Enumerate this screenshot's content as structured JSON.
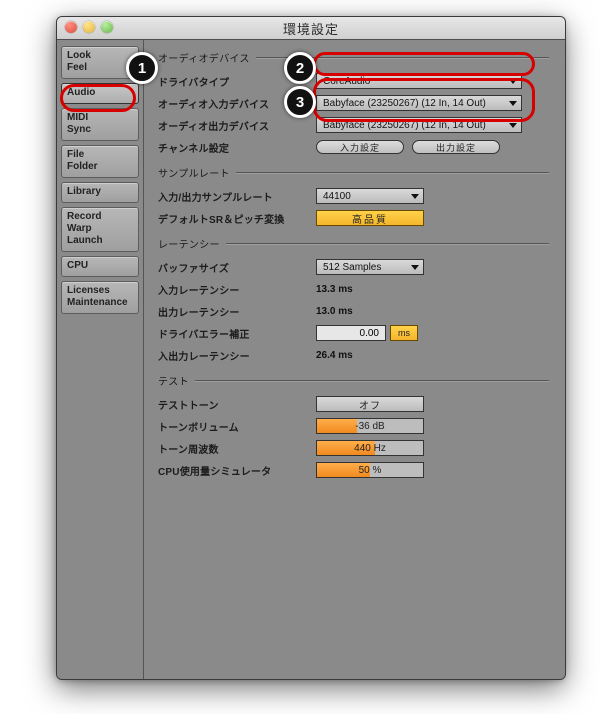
{
  "window": {
    "title": "環境設定"
  },
  "sidebar": {
    "tabs": [
      {
        "lines": [
          "Look",
          "Feel"
        ]
      },
      {
        "lines": [
          "Audio"
        ],
        "selected": true
      },
      {
        "lines": [
          "MIDI",
          "Sync"
        ]
      },
      {
        "lines": [
          "File",
          "Folder"
        ]
      },
      {
        "lines": [
          "Library"
        ]
      },
      {
        "lines": [
          "Record",
          "Warp",
          "Launch"
        ]
      },
      {
        "lines": [
          "CPU"
        ]
      },
      {
        "lines": [
          "Licenses",
          "Maintenance"
        ]
      }
    ]
  },
  "sections": {
    "device": {
      "header": "オーディオデバイス",
      "driver_type": {
        "label": "ドライバタイプ",
        "value": "CoreAudio"
      },
      "input_device": {
        "label": "オーディオ入力デバイス",
        "value": "Babyface (23250267) (12 In, 14 Out)"
      },
      "output_device": {
        "label": "オーディオ出力デバイス",
        "value": "Babyface (23250267) (12 In, 14 Out)"
      },
      "channel_config": {
        "label": "チャンネル設定",
        "input_btn": "入力設定",
        "output_btn": "出力設定"
      }
    },
    "samplerate": {
      "header": "サンプルレート",
      "io_rate": {
        "label": "入力/出力サンプルレート",
        "value": "44100"
      },
      "default_sr": {
        "label": "デフォルトSR＆ピッチ変換",
        "value": "高品質"
      }
    },
    "latency": {
      "header": "レーテンシー",
      "buffer": {
        "label": "バッファサイズ",
        "value": "512 Samples"
      },
      "in": {
        "label": "入力レーテンシー",
        "value": "13.3 ms"
      },
      "out": {
        "label": "出力レーテンシー",
        "value": "13.0 ms"
      },
      "drv": {
        "label": "ドライバエラー補正",
        "value": "0.00",
        "unit": "ms"
      },
      "total": {
        "label": "入出力レーテンシー",
        "value": "26.4 ms"
      }
    },
    "test": {
      "header": "テスト",
      "tone": {
        "label": "テストトーン",
        "value": "オフ"
      },
      "tone_vol": {
        "label": "トーンボリューム",
        "value": "-36 dB",
        "fill": 38
      },
      "tone_freq": {
        "label": "トーン周波数",
        "value": "440 Hz",
        "fill": 55
      },
      "cpu_sim": {
        "label": "CPU使用量シミュレータ",
        "value": "50 %",
        "fill": 50
      }
    }
  },
  "callouts": {
    "one": "1",
    "two": "2",
    "three": "3"
  }
}
